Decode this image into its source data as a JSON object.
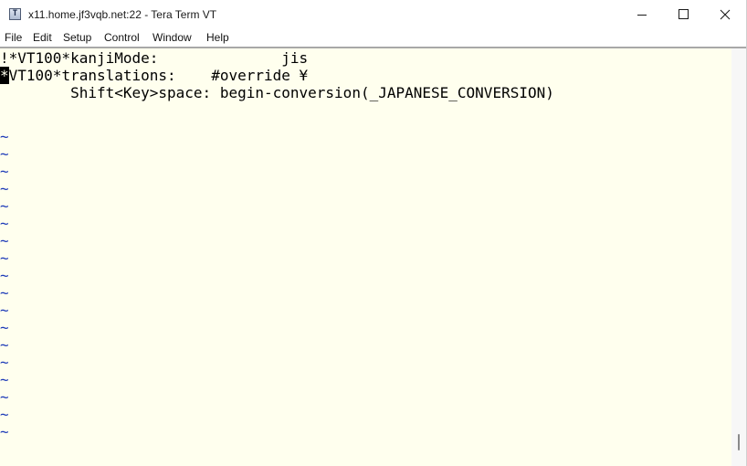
{
  "window": {
    "title": "x11.home.jf3vqb.net:22 - Tera Term VT",
    "app_icon_letter": "T",
    "app_icon": "teraterm-app-icon",
    "minimize_icon": "minimize-icon",
    "maximize_icon": "maximize-icon",
    "close_icon": "close-icon"
  },
  "menu": {
    "items": [
      "File",
      "Edit",
      "Setup",
      "Control",
      "Window",
      "Help"
    ]
  },
  "terminal": {
    "background": "#ffffee",
    "foreground": "#000000",
    "tilde_color": "#1d3ab8",
    "lines": [
      {
        "text": "!*VT100*kanjiMode:              jis"
      },
      {
        "cursor_char": "*",
        "text": "VT100*translations:    #override ¥"
      },
      {
        "text": "        Shift<Key>space: begin-conversion(_JAPANESE_CONVERSION)"
      }
    ],
    "empty_line_marker": "~",
    "empty_line_count": 18
  },
  "scrollbar": {
    "position": 1.0
  }
}
